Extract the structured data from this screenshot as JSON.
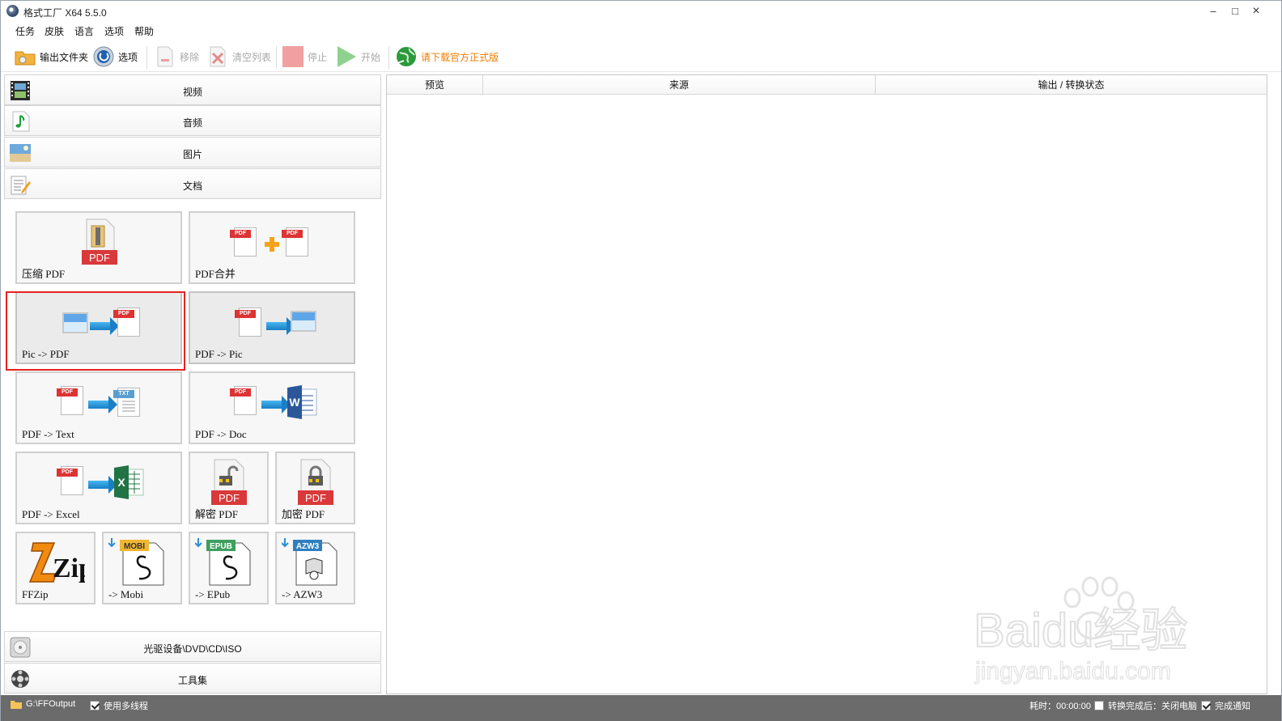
{
  "window": {
    "title": "格式工厂 X64 5.5.0",
    "controls": {
      "minimize": "–",
      "maximize": "□",
      "close": "×"
    }
  },
  "menu": [
    "任务",
    "皮肤",
    "语言",
    "选项",
    "帮助"
  ],
  "toolbar": {
    "output_folder": "输出文件夹",
    "options": "选项",
    "remove": "移除",
    "clear_list": "清空列表",
    "stop": "停止",
    "start": "开始",
    "download": "请下载官方正式版",
    "accent_color": "#f07d00"
  },
  "categories": {
    "video": "视频",
    "audio": "音频",
    "picture": "图片",
    "document": "文档",
    "disc": "光驱设备\\DVD\\CD\\ISO",
    "tools": "工具集"
  },
  "tiles": [
    {
      "label": "压缩 PDF",
      "icon": "compress-pdf-icon"
    },
    {
      "label": "PDF合并",
      "icon": "pdf-merge-icon"
    },
    {
      "label": "Pic -> PDF",
      "icon": "pic-to-pdf-icon"
    },
    {
      "label": "PDF -> Pic",
      "icon": "pdf-to-pic-icon"
    },
    {
      "label": "PDF -> Text",
      "icon": "pdf-to-text-icon"
    },
    {
      "label": "PDF -> Doc",
      "icon": "pdf-to-doc-icon"
    },
    {
      "label": "PDF -> Excel",
      "icon": "pdf-to-excel-icon"
    },
    {
      "label": "解密 PDF",
      "icon": "decrypt-pdf-icon"
    },
    {
      "label": "加密 PDF",
      "icon": "encrypt-pdf-icon"
    },
    {
      "label": "FFZip",
      "icon": "ffzip-icon"
    },
    {
      "label": "-> Mobi",
      "icon": "mobi-icon"
    },
    {
      "label": "-> EPub",
      "icon": "epub-icon"
    },
    {
      "label": "-> AZW3",
      "icon": "azw3-icon"
    }
  ],
  "icon_text": {
    "pdf": "PDF",
    "txt": "TXT",
    "mobi": "MOBI",
    "epub": "EPUB",
    "azw3": "AZW3",
    "word": "W",
    "excel": "X",
    "zip": "Zip"
  },
  "table": {
    "columns": [
      "预览",
      "来源",
      "输出 / 转换状态"
    ]
  },
  "status": {
    "output_path": "G:\\FFOutput",
    "multithread": "使用多线程",
    "multithread_checked": true,
    "elapsed": "耗时：00:00:00",
    "after_convert": "转换完成后：关闭电脑",
    "after_convert_checked": false,
    "notify": "完成通知",
    "notify_checked": true
  },
  "watermark": {
    "brand": "Baidu经验",
    "url": "jingyan.baidu.com"
  }
}
